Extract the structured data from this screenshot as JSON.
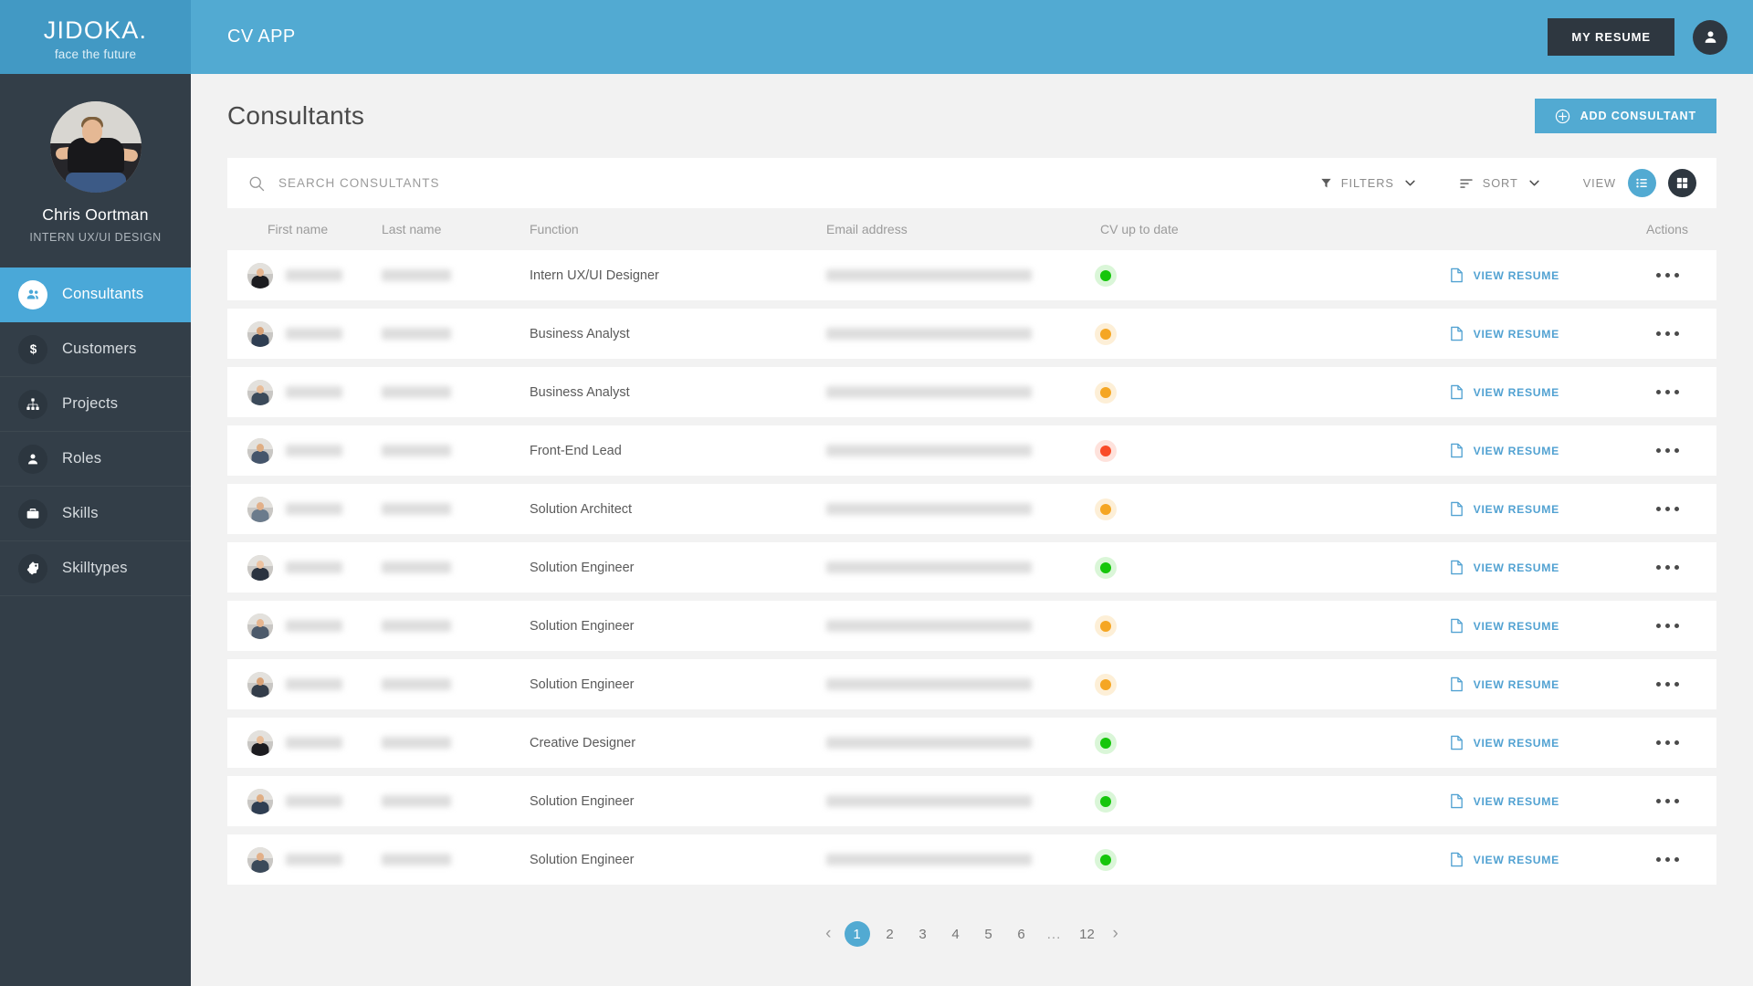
{
  "brand": {
    "name": "JIDOKA.",
    "tagline": "face the future",
    "logo_bg": "#4299c4",
    "topbar_bg": "#52aad2",
    "sidebar_bg": "#333e48",
    "accent": "#52aad2",
    "dark": "#2e3740"
  },
  "profile": {
    "name": "Chris Oortman",
    "role": "INTERN UX/UI DESIGN",
    "avatar_icon": "user-photo"
  },
  "sidebar": {
    "items": [
      {
        "label": "Consultants",
        "icon": "people-icon",
        "active": true
      },
      {
        "label": "Customers",
        "icon": "dollar-icon",
        "active": false
      },
      {
        "label": "Projects",
        "icon": "sitemap-icon",
        "active": false
      },
      {
        "label": "Roles",
        "icon": "person-icon",
        "active": false
      },
      {
        "label": "Skills",
        "icon": "briefcase-icon",
        "active": false
      },
      {
        "label": "Skilltypes",
        "icon": "tag-icon",
        "active": false
      }
    ]
  },
  "topbar": {
    "app_title": "CV APP",
    "resume_button": "MY RESUME",
    "user_icon": "user-icon"
  },
  "page": {
    "title": "Consultants",
    "add_button": "ADD CONSULTANT",
    "add_icon": "plus-circle-icon"
  },
  "toolbar": {
    "search_placeholder": "SEARCH CONSULTANTS",
    "search_value": "",
    "search_icon": "search-icon",
    "filters_label": "FILTERS",
    "filters_icon": "funnel-icon",
    "sort_label": "SORT",
    "sort_icon": "sort-lines-icon",
    "view_label": "VIEW",
    "view_list_icon": "list-view-icon",
    "view_grid_icon": "grid-view-icon",
    "active_view": "list"
  },
  "table": {
    "columns": [
      "First name",
      "Last name",
      "Function",
      "Email address",
      "CV up to date",
      "Actions"
    ],
    "view_resume_label": "VIEW RESUME",
    "resume_icon": "document-icon",
    "actions_icon": "kebab-menu-icon",
    "rows": [
      {
        "first_name": "",
        "last_name": "",
        "function": "Intern UX/UI Designer",
        "email": "",
        "cv_status": "green"
      },
      {
        "first_name": "",
        "last_name": "",
        "function": "Business Analyst",
        "email": "",
        "cv_status": "orange"
      },
      {
        "first_name": "",
        "last_name": "",
        "function": "Business Analyst",
        "email": "",
        "cv_status": "orange"
      },
      {
        "first_name": "",
        "last_name": "",
        "function": "Front-End Lead",
        "email": "",
        "cv_status": "red"
      },
      {
        "first_name": "",
        "last_name": "",
        "function": "Solution Architect",
        "email": "",
        "cv_status": "orange"
      },
      {
        "first_name": "",
        "last_name": "",
        "function": "Solution Engineer",
        "email": "",
        "cv_status": "green"
      },
      {
        "first_name": "",
        "last_name": "",
        "function": "Solution Engineer",
        "email": "",
        "cv_status": "orange"
      },
      {
        "first_name": "",
        "last_name": "",
        "function": "Solution Engineer",
        "email": "",
        "cv_status": "orange"
      },
      {
        "first_name": "",
        "last_name": "",
        "function": "Creative Designer",
        "email": "",
        "cv_status": "green"
      },
      {
        "first_name": "",
        "last_name": "",
        "function": "Solution Engineer",
        "email": "",
        "cv_status": "green"
      },
      {
        "first_name": "",
        "last_name": "",
        "function": "Solution Engineer",
        "email": "",
        "cv_status": "green"
      }
    ]
  },
  "pagination": {
    "prev_icon": "chevron-left-icon",
    "next_icon": "chevron-right-icon",
    "pages": [
      "1",
      "2",
      "3",
      "4",
      "5",
      "6",
      "...",
      "12"
    ],
    "current": "1"
  }
}
